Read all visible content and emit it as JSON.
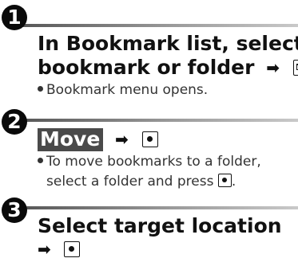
{
  "steps": [
    {
      "number": "1",
      "heading_line1": "In Bookmark list, select",
      "heading_line2": "bookmark or folder",
      "key_icon": "mail-key-icon",
      "note": "Bookmark menu opens."
    },
    {
      "number": "2",
      "menu_label": "Move",
      "key_icon": "center-key-icon",
      "note_line1": "To move bookmarks to a folder,",
      "note_line2": "select a folder and press"
    },
    {
      "number": "3",
      "heading_line1": "Select target location",
      "key_icon": "center-key-icon"
    }
  ],
  "arrow_glyph": "➡",
  "note_end": "."
}
